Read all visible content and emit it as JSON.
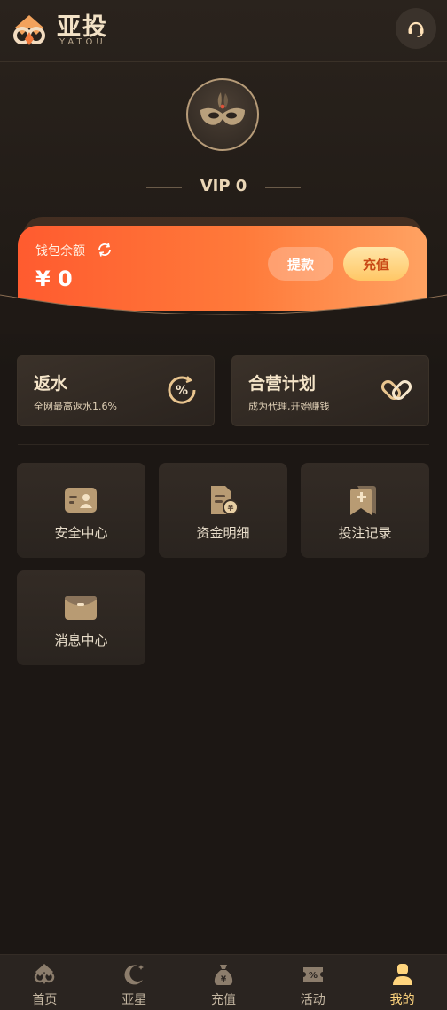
{
  "header": {
    "brand_name": "亚投",
    "brand_sub": "YATOU",
    "support_icon": "headset-icon"
  },
  "profile": {
    "avatar_icon": "masquerade-mask-icon",
    "vip_level": "VIP 0"
  },
  "wallet": {
    "label": "钱包余额",
    "refresh_icon": "refresh-icon",
    "amount": "¥ 0",
    "withdraw_label": "提款",
    "deposit_label": "充值"
  },
  "promos": [
    {
      "title": "返水",
      "subtitle": "全网最高返水1.6%",
      "icon": "percent-refresh-icon"
    },
    {
      "title": "合营计划",
      "subtitle": "成为代理,开始赚钱",
      "icon": "partnership-icon"
    }
  ],
  "menu": [
    {
      "label": "安全中心",
      "icon": "id-card-icon"
    },
    {
      "label": "资金明细",
      "icon": "fund-document-icon"
    },
    {
      "label": "投注记录",
      "icon": "bookmark-plus-icon"
    },
    {
      "label": "消息中心",
      "icon": "envelope-icon"
    }
  ],
  "nav": {
    "items": [
      {
        "label": "首页",
        "icon": "home-logo-icon",
        "active": false
      },
      {
        "label": "亚星",
        "icon": "moon-star-icon",
        "active": false
      },
      {
        "label": "充值",
        "icon": "money-bag-icon",
        "active": false
      },
      {
        "label": "活动",
        "icon": "ticket-percent-icon",
        "active": false
      },
      {
        "label": "我的",
        "icon": "user-icon",
        "active": true
      }
    ]
  },
  "colors": {
    "accent_gold": "#ffd57e",
    "wallet_start": "#ff5b2f",
    "wallet_end": "#ffa262",
    "background": "#1c1714"
  }
}
